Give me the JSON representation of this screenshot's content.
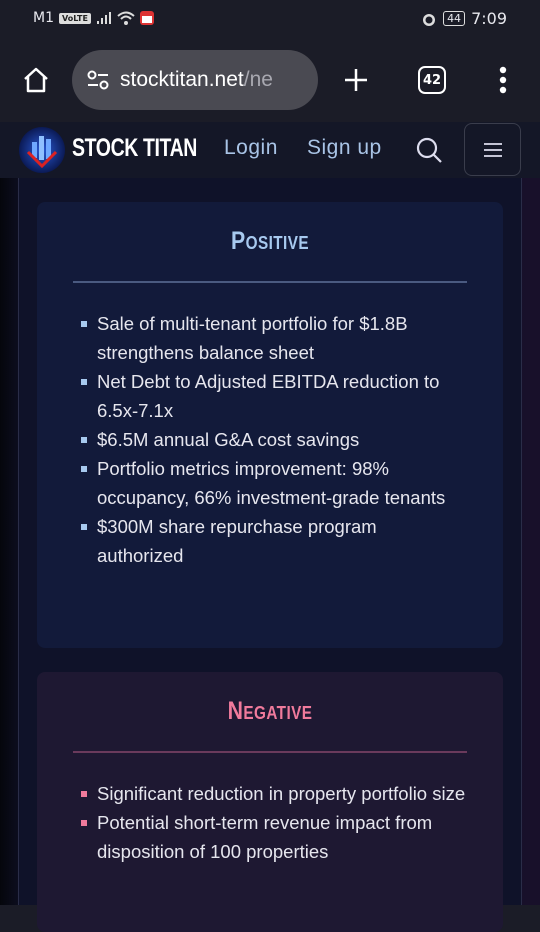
{
  "status_bar": {
    "carrier": "M1",
    "volte": "VoLTE",
    "battery": "44",
    "time": "7:09"
  },
  "browser": {
    "url_host": "stocktitan.net",
    "url_path": "/ne",
    "tab_count": "42"
  },
  "site": {
    "brand": "STOCK TITAN",
    "login": "Login",
    "signup": "Sign up"
  },
  "positive": {
    "title": "Positive",
    "items": [
      "Sale of multi-tenant portfolio for $1.8B strengthens balance sheet",
      "Net Debt to Adjusted EBITDA reduction to 6.5x-7.1x",
      "$6.5M annual G&A cost savings",
      "Portfolio metrics improvement: 98% occupancy, 66% investment-grade tenants",
      "$300M share repurchase program authorized"
    ]
  },
  "negative": {
    "title": "Negative",
    "items": [
      "Significant reduction in property portfolio size",
      "Potential short-term revenue impact from disposition of 100 properties"
    ]
  },
  "colors": {
    "positive": "#a7c9ef",
    "negative": "#f07a9c",
    "nav_link": "#a9c4e6"
  }
}
